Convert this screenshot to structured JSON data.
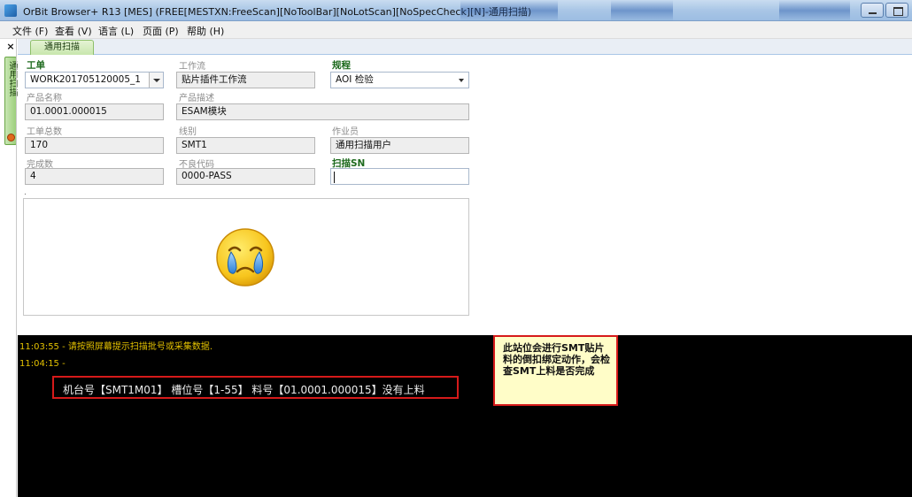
{
  "window": {
    "title": "OrBit Browser+ R13 [MES] (FREE[MESTXN:FreeScan][NoToolBar][NoLotScan][NoSpecCheck][N]-通用扫描)"
  },
  "menu": [
    "文件 (F)",
    "查看 (V)",
    "语言 (L)",
    "页面 (P)",
    "帮助 (H)"
  ],
  "sidebar": {
    "close": "×",
    "tab_label": "通用扫描"
  },
  "tab": {
    "label": "通用扫描"
  },
  "form": {
    "work_order": {
      "label": "工单",
      "value": "WORK201705120005_1"
    },
    "workflow": {
      "label": "工作流",
      "value": "贴片插件工作流"
    },
    "rule": {
      "label": "规程",
      "value": "AOI 检验"
    },
    "product_name": {
      "label": "产品名称",
      "value": "01.0001.000015"
    },
    "product_desc": {
      "label": "产品描述",
      "value": "ESAM模块"
    },
    "total_qty": {
      "label": "工单总数",
      "value": "170"
    },
    "line": {
      "label": "线别",
      "value": "SMT1"
    },
    "operator": {
      "label": "作业员",
      "value": "通用扫描用户"
    },
    "done_qty": {
      "label": "完成数",
      "value": "4"
    },
    "defect_code": {
      "label": "不良代码",
      "value": "0000-PASS"
    },
    "scan_sn": {
      "label": "扫描SN",
      "value": ""
    },
    "dot": "."
  },
  "result": {
    "status_icon": "crying-face-icon"
  },
  "console": {
    "line1": "11:03:55 - 请按照屏幕提示扫描批号或采集数据.",
    "line2": "11:04:15 -",
    "error": "机台号【SMT1M01】 槽位号【1-55】 料号【01.0001.000015】没有上料"
  },
  "callout": {
    "text": "此站位会进行SMT贴片料的倒扣绑定动作，会检查SMT上料是否完成"
  },
  "colors": {
    "label_green": "#1d6a1d",
    "console_bg": "#000000",
    "console_text": "#e3c100",
    "error_border": "#d61a1a",
    "callout_bg": "#fffdc8"
  }
}
